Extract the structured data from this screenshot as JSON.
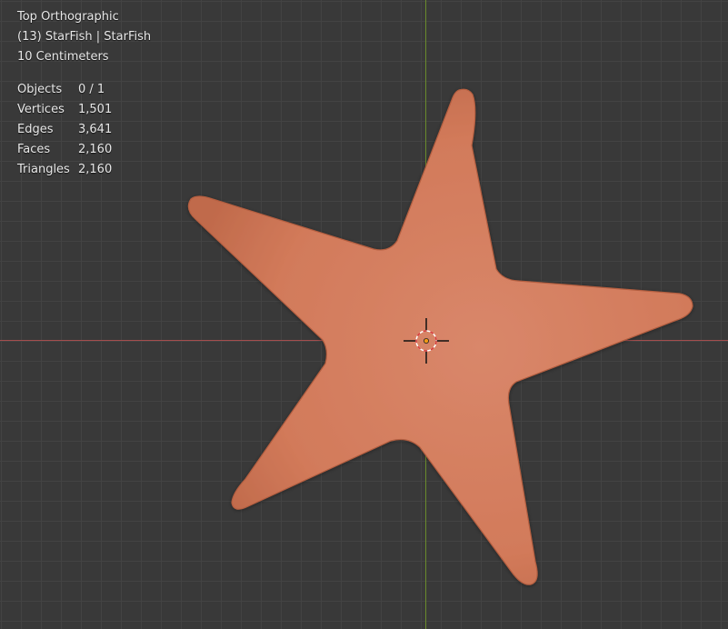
{
  "viewport": {
    "view_name": "Top Orthographic",
    "object_label": "(13) StarFish | StarFish",
    "scale_label": "10 Centimeters"
  },
  "stats": [
    {
      "label": "Objects",
      "value": "0 / 1"
    },
    {
      "label": "Vertices",
      "value": "1,501"
    },
    {
      "label": "Edges",
      "value": "3,641"
    },
    {
      "label": "Faces",
      "value": "2,160"
    },
    {
      "label": "Triangles",
      "value": "2,160"
    }
  ],
  "colors": {
    "background": "#393939",
    "grid": "#434343",
    "x_axis": "#a44e4e",
    "y_axis": "#6a8b2c",
    "mesh": "#d27a5a"
  },
  "icons": {
    "cursor": "3d-cursor-icon",
    "origin": "origin-dot-icon"
  }
}
